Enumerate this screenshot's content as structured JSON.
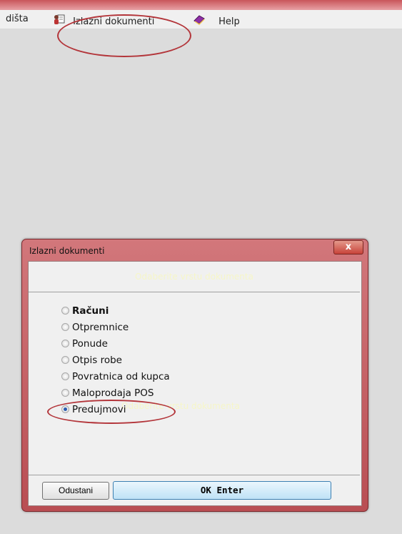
{
  "menubar": {
    "items": [
      {
        "label": "dišta",
        "icon": ""
      },
      {
        "label": "Izlazni dokumenti",
        "icon": "person-document-icon"
      },
      {
        "label": "Help",
        "icon": "help-book-icon"
      }
    ]
  },
  "dialog": {
    "title": "Izlazni dokumenti",
    "close_label": "x",
    "header_text": "Odaberite vrstu dokumenta",
    "ghost_text": "Odaberite vrstu dokumenta",
    "options": [
      {
        "label": "Računi",
        "selected": false
      },
      {
        "label": "Otpremnice",
        "selected": false
      },
      {
        "label": "Ponude",
        "selected": false
      },
      {
        "label": "Otpis robe",
        "selected": false
      },
      {
        "label": "Povratnica od kupca",
        "selected": false
      },
      {
        "label": "Maloprodaja POS",
        "selected": false
      },
      {
        "label": "Predujmovi",
        "selected": true
      }
    ],
    "cancel_label": "Odustani",
    "ok_label": "OK Enter"
  },
  "colors": {
    "accent": "#c8434a",
    "highlight_ellipse": "#b3353a",
    "ok_button": "#bfe2f6"
  }
}
